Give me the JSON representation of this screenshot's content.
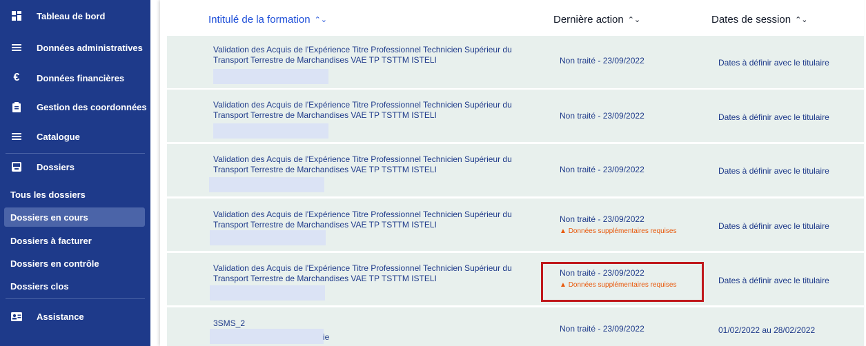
{
  "sidebar": {
    "items": [
      {
        "label": "Tableau de bord",
        "icon": "dashboard-icon"
      },
      {
        "label": "Données administratives",
        "icon": "list-icon"
      },
      {
        "label": "Données financières",
        "icon": "euro-icon"
      },
      {
        "label": "Gestion des coordonnées",
        "icon": "clipboard-icon"
      },
      {
        "label": "Catalogue",
        "icon": "list-icon"
      },
      {
        "label": "Dossiers",
        "icon": "inbox-icon"
      }
    ],
    "subitems": [
      {
        "label": "Tous les dossiers"
      },
      {
        "label": "Dossiers en cours"
      },
      {
        "label": "Dossiers à facturer"
      },
      {
        "label": "Dossiers en contrôle"
      },
      {
        "label": "Dossiers clos"
      }
    ],
    "assistance": {
      "label": "Assistance",
      "icon": "contact-card-icon"
    }
  },
  "table": {
    "headers": {
      "title": "Intitulé de la formation",
      "action": "Dernière action",
      "dates": "Dates de session",
      "sort_icon": "sort-icon"
    },
    "rows": [
      {
        "formation": "Validation des Acquis de l'Expérience Titre Professionnel Technicien Supérieur du Transport Terrestre de Marchandises VAE TP TSTTM ISTELI",
        "action": "Non traité - 23/09/2022",
        "warning": "",
        "dates": "Dates à définir avec le titulaire"
      },
      {
        "formation": "Validation des Acquis de l'Expérience Titre Professionnel Technicien Supérieur du Transport Terrestre de Marchandises VAE TP TSTTM ISTELI",
        "action": "Non traité - 23/09/2022",
        "warning": "",
        "dates": "Dates à définir avec le titulaire"
      },
      {
        "formation": "Validation des Acquis de l'Expérience Titre Professionnel Technicien Supérieur du Transport Terrestre de Marchandises VAE TP TSTTM ISTELI",
        "action": "Non traité - 23/09/2022",
        "warning": "",
        "dates": "Dates à définir avec le titulaire"
      },
      {
        "formation": "Validation des Acquis de l'Expérience Titre Professionnel Technicien Supérieur du Transport Terrestre de Marchandises VAE TP TSTTM ISTELI",
        "action": "Non traité - 23/09/2022",
        "warning": "Données supplémentaires requises",
        "dates": "Dates à définir avec le titulaire"
      },
      {
        "formation": "Validation des Acquis de l'Expérience Titre Professionnel Technicien Supérieur du Transport Terrestre de Marchandises VAE TP TSTTM ISTELI",
        "action": "Non traité - 23/09/2022",
        "warning": "Données supplémentaires requises",
        "dates": "Dates à définir avec le titulaire"
      },
      {
        "formation": "3SMS_2",
        "formation_tail": "ie",
        "action": "Non traité - 23/09/2022",
        "warning": "",
        "dates": "01/02/2022 au 28/02/2022"
      }
    ]
  },
  "colors": {
    "sidebar_bg": "#1e3a8a",
    "row_bg": "#e8f0ed",
    "warning": "#e8590c",
    "highlight": "#c0191c",
    "link": "#1d4ed8"
  }
}
